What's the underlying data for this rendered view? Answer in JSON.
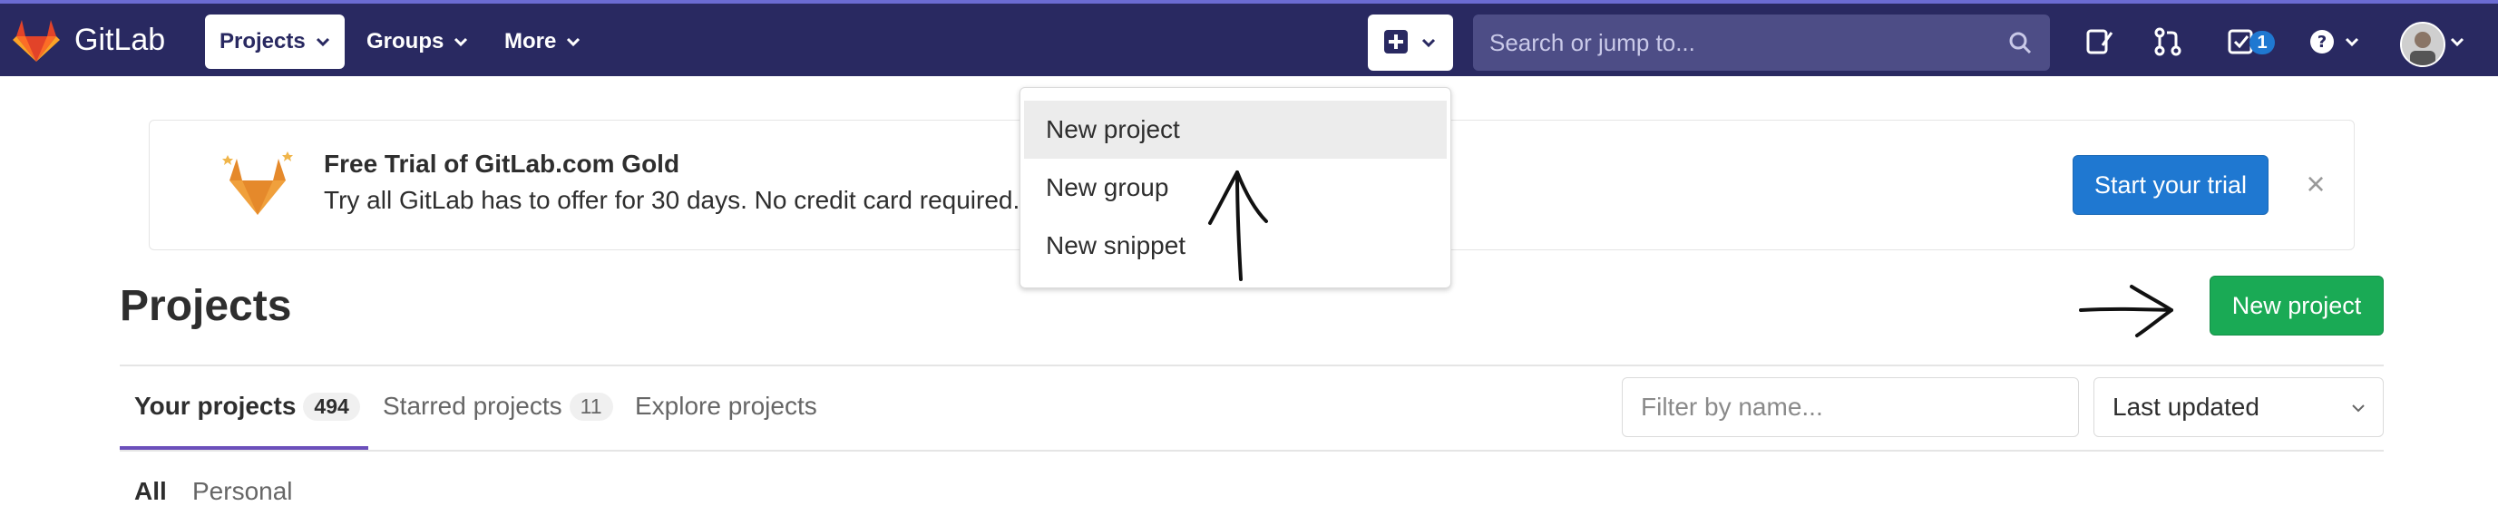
{
  "navbar": {
    "brand": "GitLab",
    "projects_label": "Projects",
    "groups_label": "Groups",
    "more_label": "More",
    "search_placeholder": "Search or jump to...",
    "todo_count": "1",
    "icons": [
      "gitlab-logo-icon",
      "plus-square-icon",
      "chevron-down-icon",
      "search-icon",
      "issues-icon",
      "merge-request-icon",
      "todo-icon",
      "help-icon",
      "avatar"
    ]
  },
  "banner": {
    "title": "Free Trial of GitLab.com Gold",
    "text": "Try all GitLab has to offer for 30 days. No credit card required.",
    "trial_button": "Start your trial",
    "close_glyph": "×"
  },
  "dropdown": {
    "items": [
      {
        "label": "New project"
      },
      {
        "label": "New group"
      },
      {
        "label": "New snippet"
      }
    ]
  },
  "page": {
    "title": "Projects",
    "new_project_button": "New project"
  },
  "tabs": [
    {
      "label": "Your projects",
      "count": "494"
    },
    {
      "label": "Starred projects",
      "count": "11"
    },
    {
      "label": "Explore projects"
    }
  ],
  "filter": {
    "placeholder": "Filter by name...",
    "sort_value": "Last updated"
  },
  "subtabs": [
    "All",
    "Personal"
  ],
  "colors": {
    "navbar": "#292961",
    "primary": "#1f78d1",
    "success": "#1aaa55",
    "active_tab": "#6b4fbb"
  }
}
